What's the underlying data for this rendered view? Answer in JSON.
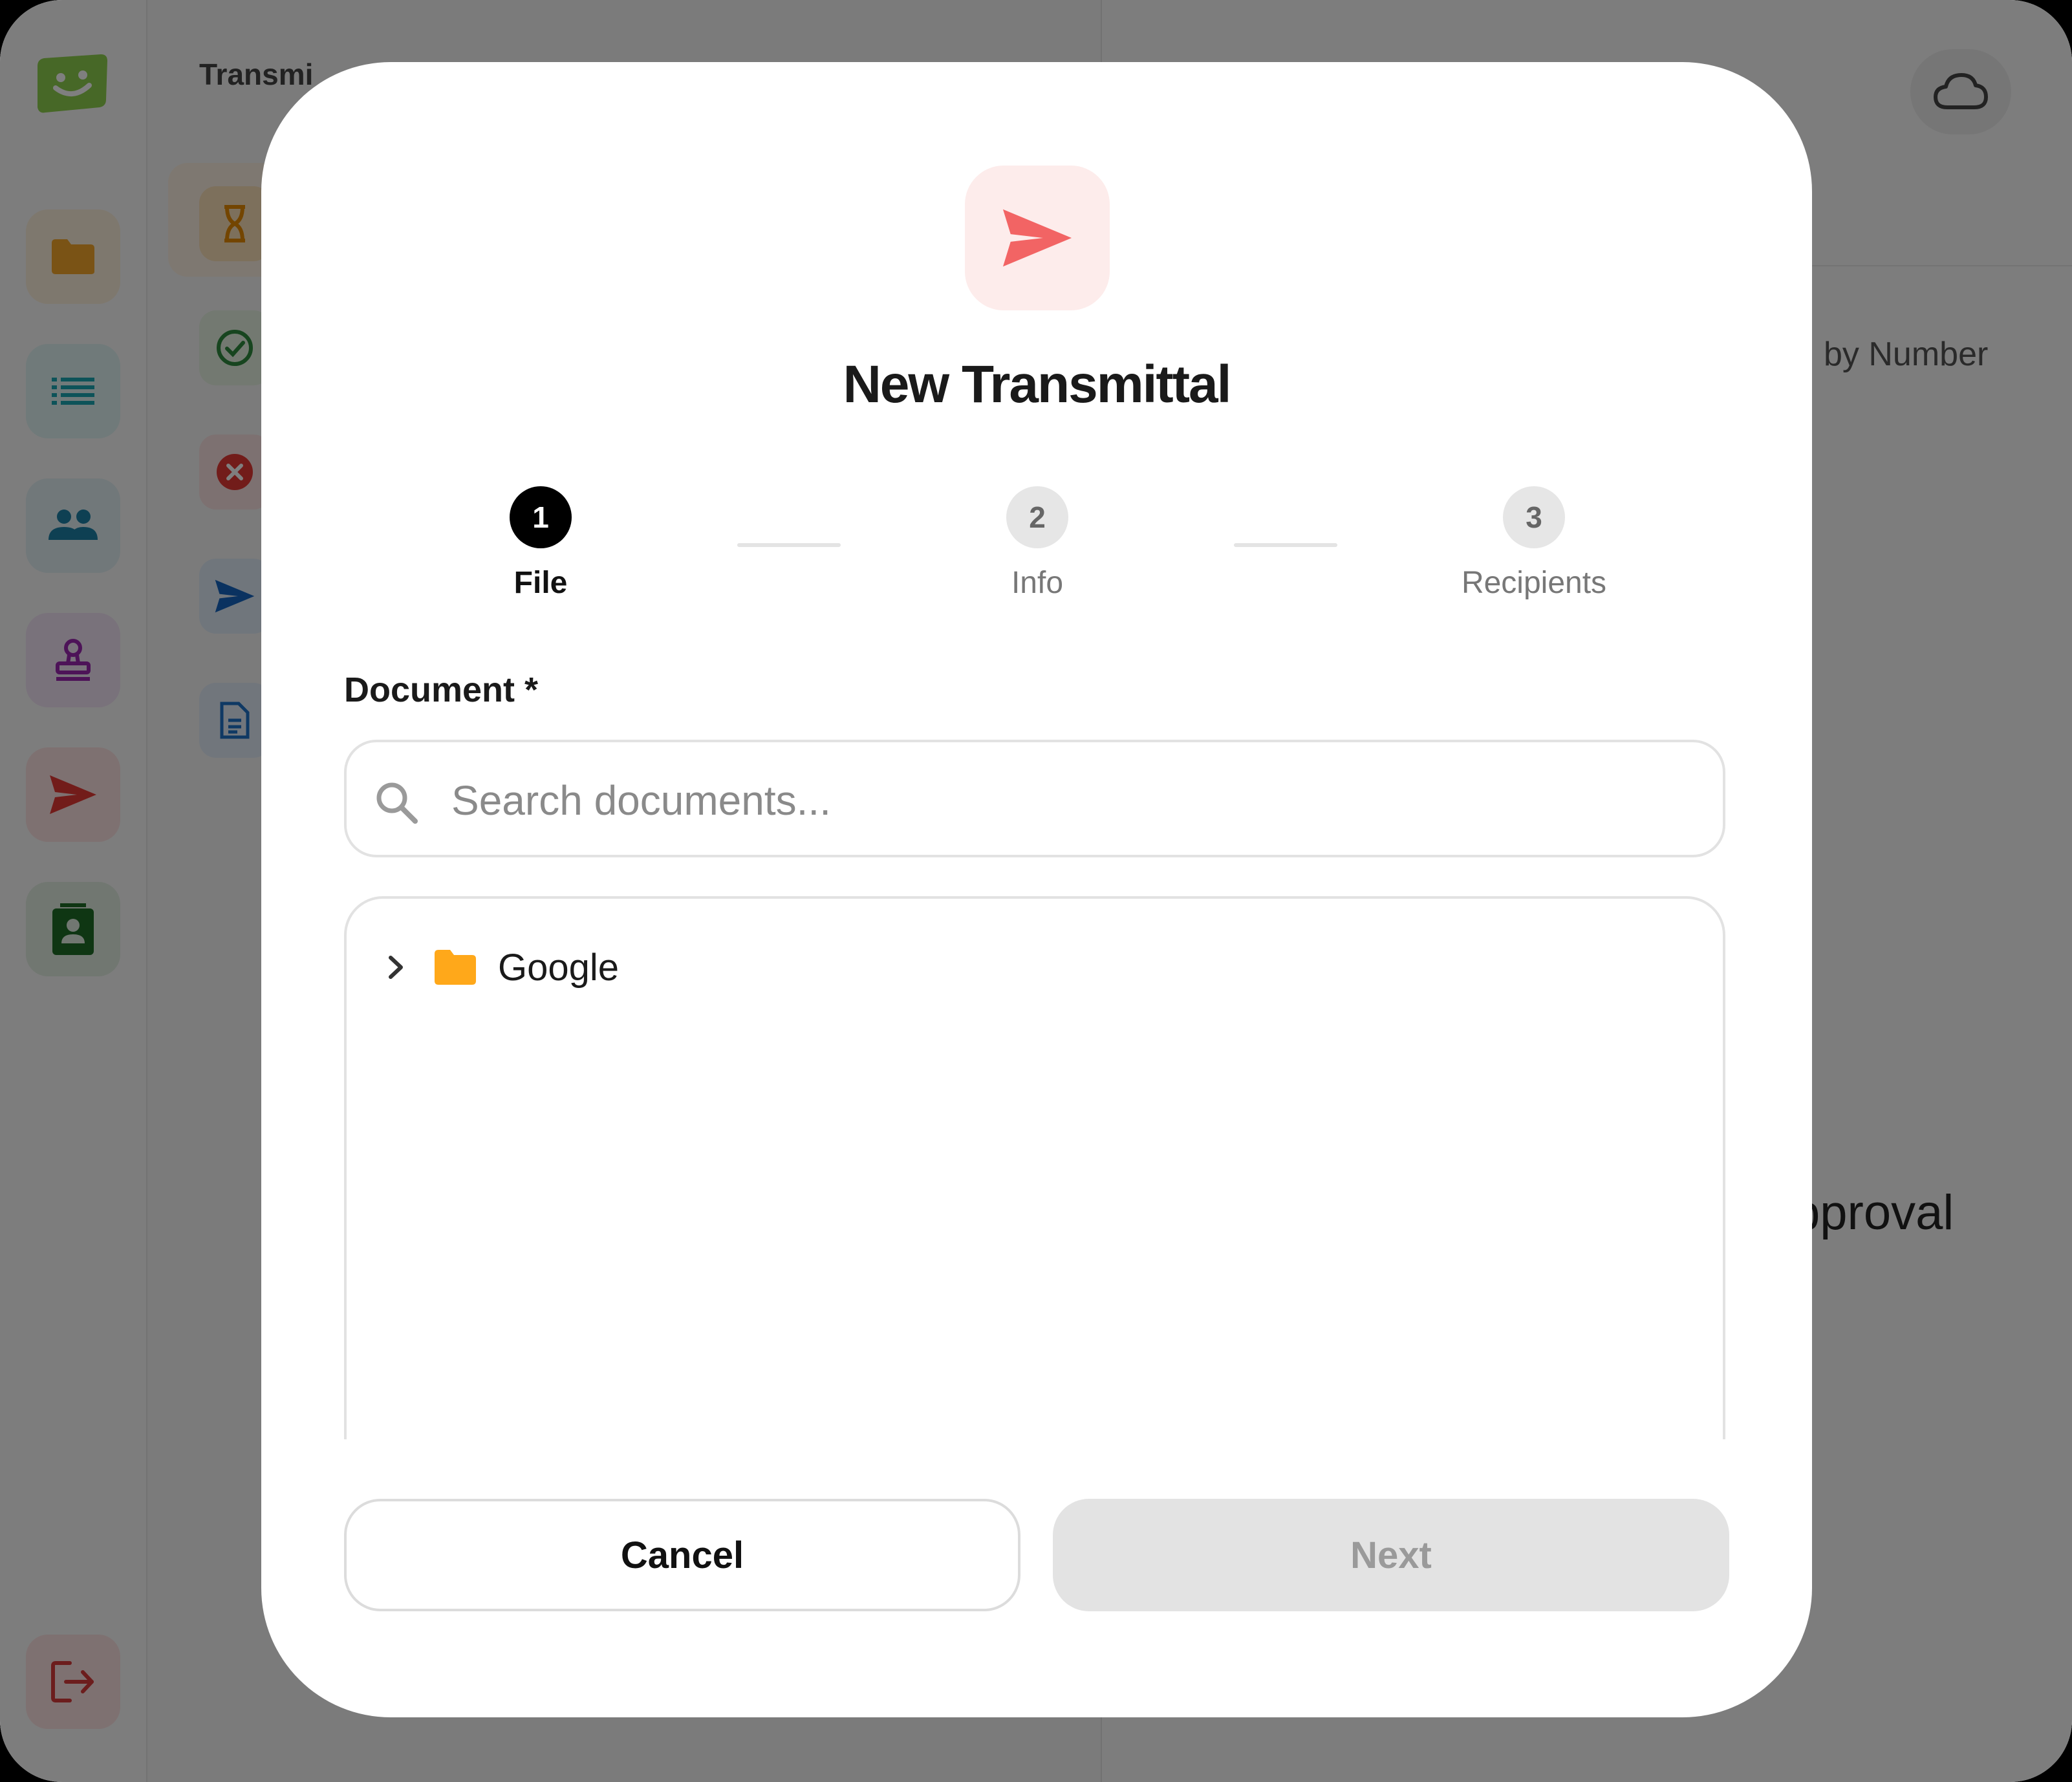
{
  "background": {
    "breadcrumb": "Transmi",
    "header_text": "by Number",
    "panel_text": "pproval",
    "sidebar_icons": [
      "app-logo-icon",
      "folder-icon",
      "list-icon",
      "people-icon",
      "stamp-icon",
      "send-icon",
      "contact-card-icon",
      "logout-icon"
    ],
    "sublist_icons": [
      "hourglass-icon",
      "check-circle-icon",
      "x-circle-icon",
      "send-icon",
      "document-icon"
    ]
  },
  "modal": {
    "title": "New Transmittal",
    "steps": [
      {
        "number": "1",
        "label": "File",
        "active": true
      },
      {
        "number": "2",
        "label": "Info",
        "active": false
      },
      {
        "number": "3",
        "label": "Recipients",
        "active": false
      }
    ],
    "document_label": "Document *",
    "search": {
      "placeholder": "Search documents...",
      "value": ""
    },
    "tree": [
      {
        "name": "Google",
        "type": "folder",
        "expanded": false
      }
    ],
    "buttons": {
      "cancel": "Cancel",
      "next": "Next",
      "next_disabled": true
    }
  },
  "colors": {
    "accent_red": "#f26464",
    "folder_orange": "#ffa81a",
    "active_step": "#000000"
  }
}
